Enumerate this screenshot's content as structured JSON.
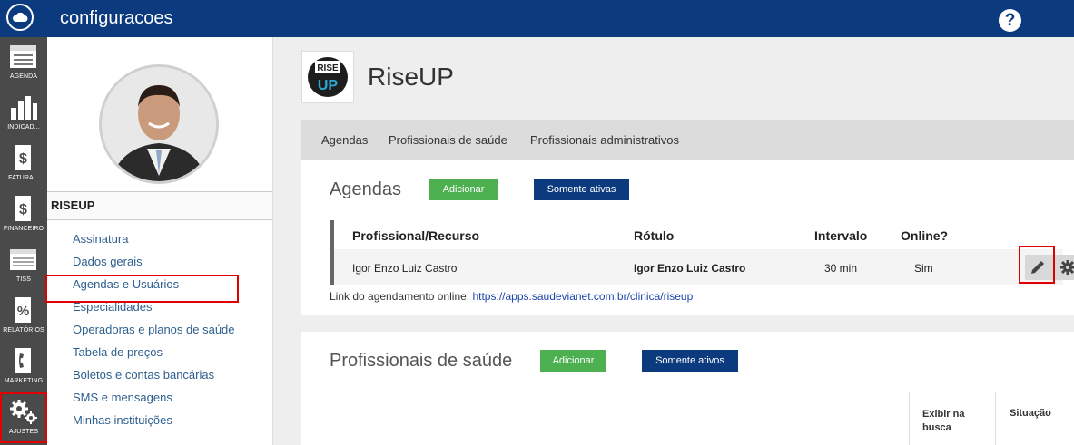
{
  "app": {
    "title": "configuracoes",
    "help_label": "?"
  },
  "leftnav": {
    "items": [
      {
        "label": "AGENDA",
        "icon": "calendar-icon"
      },
      {
        "label": "INDICAD...",
        "icon": "bar-chart-icon"
      },
      {
        "label": "FATURA...",
        "icon": "dollar-document-icon"
      },
      {
        "label": "FINANCEIRO",
        "icon": "dollar-document-icon"
      },
      {
        "label": "TISS",
        "icon": "tiss-document-icon"
      },
      {
        "label": "RELATÓRIOS",
        "icon": "percent-document-icon"
      },
      {
        "label": "MARKETING",
        "icon": "phone-icon"
      },
      {
        "label": "AJUSTES",
        "icon": "gears-icon"
      }
    ],
    "active": "AJUSTES"
  },
  "profile": {
    "org_name": "RISEUP",
    "menu": [
      "Assinatura",
      "Dados gerais",
      "Agendas e Usuários",
      "Especialidades",
      "Operadoras e planos de saúde",
      "Tabela de preços",
      "Boletos e contas bancárias",
      "SMS e mensagens",
      "Minhas instituições"
    ],
    "selected": "Agendas e Usuários"
  },
  "header": {
    "brand": "RiseUP",
    "logo_text": "RISE UP"
  },
  "tabs": [
    "Agendas",
    "Profissionais de saúde",
    "Profissionais administrativos"
  ],
  "agendas": {
    "title": "Agendas",
    "add_label": "Adicionar",
    "filter_label": "Somente ativas",
    "columns": [
      "Profissional/Recurso",
      "Rótulo",
      "Intervalo",
      "Online?"
    ],
    "rows": [
      {
        "profissional": "Igor Enzo Luiz Castro",
        "rotulo": "Igor Enzo Luiz Castro",
        "intervalo": "30 min",
        "online": "Sim"
      }
    ],
    "link_label": "Link do agendamento online:",
    "link_url": "https://apps.saudevianet.com.br/clinica/riseup"
  },
  "profissionais": {
    "title": "Profissionais de saúde",
    "add_label": "Adicionar",
    "filter_label": "Somente ativos",
    "columns": [
      "Exibir na busca",
      "Situação"
    ]
  },
  "colors": {
    "topbar": "#0b3a7e",
    "nav": "#4a4a4a",
    "green": "#4caf50",
    "highlight": "#e00000"
  }
}
